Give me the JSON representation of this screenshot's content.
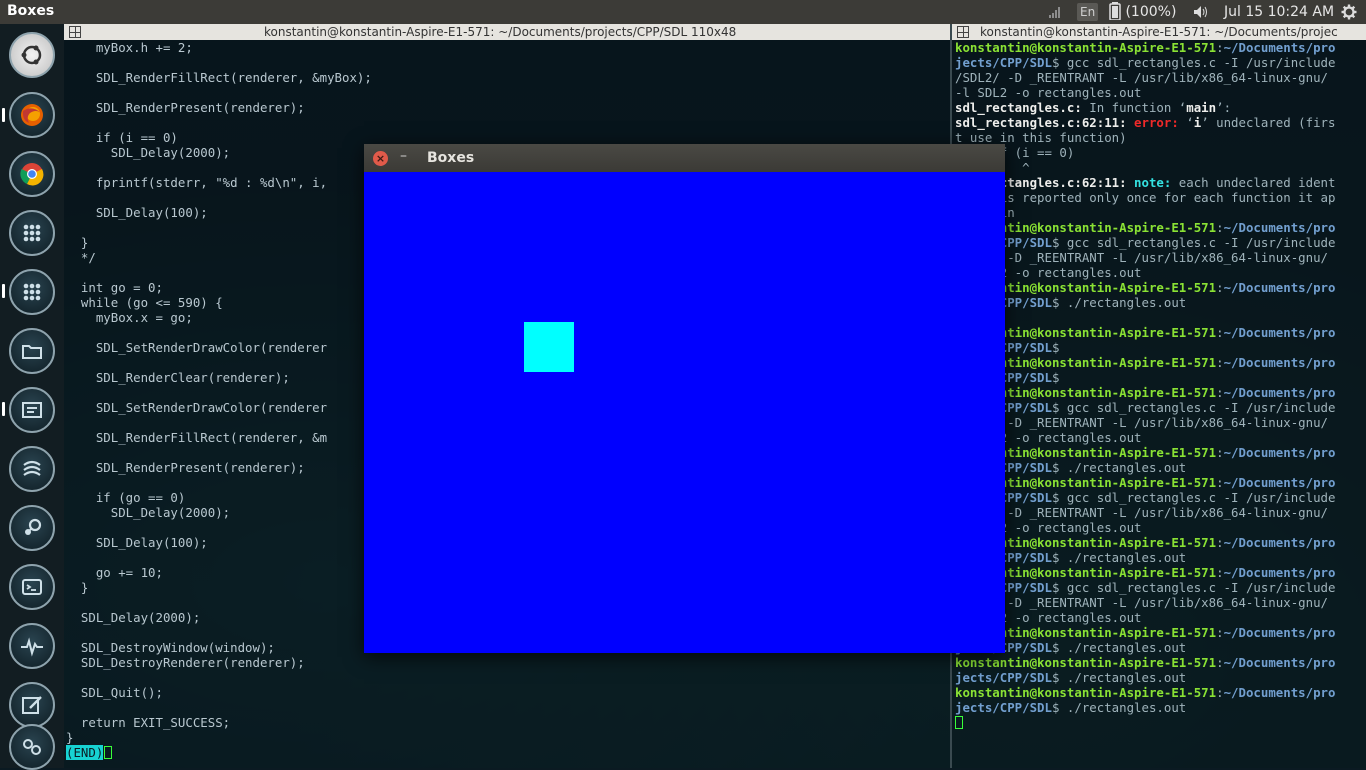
{
  "top_panel": {
    "app_title": "Boxes",
    "language": "En",
    "battery": "(100%)",
    "clock": "Jul 15 10:24 AM"
  },
  "launcher": {
    "items": [
      "ubuntu-dash",
      "firefox",
      "chrome",
      "apps",
      "apps",
      "files",
      "editor",
      "sublime",
      "steam",
      "terminal",
      "system-monitor",
      "paint",
      "settings",
      "trash"
    ]
  },
  "term_left": {
    "title": "konstantin@konstantin-Aspire-E1-571: ~/Documents/projects/CPP/SDL 110x48",
    "lines": [
      "    myBox.h += 2;",
      "",
      "    SDL_RenderFillRect(renderer, &myBox);",
      "",
      "    SDL_RenderPresent(renderer);",
      "",
      "    if (i == 0)",
      "      SDL_Delay(2000);",
      "",
      "    fprintf(stderr, \"%d : %d\\n\", i,",
      "",
      "    SDL_Delay(100);",
      "",
      "  }",
      "  */",
      "",
      "  int go = 0;",
      "  while (go <= 590) {",
      "    myBox.x = go;",
      "",
      "    SDL_SetRenderDrawColor(renderer",
      "",
      "    SDL_RenderClear(renderer);",
      "",
      "    SDL_SetRenderDrawColor(renderer",
      "",
      "    SDL_RenderFillRect(renderer, &m",
      "",
      "    SDL_RenderPresent(renderer);",
      "",
      "    if (go == 0)",
      "      SDL_Delay(2000);",
      "",
      "    SDL_Delay(100);",
      "",
      "    go += 10;",
      "  }",
      "",
      "  SDL_Delay(2000);",
      "",
      "  SDL_DestroyWindow(window);",
      "  SDL_DestroyRenderer(renderer);",
      "",
      "  SDL_Quit();",
      "",
      "  return EXIT_SUCCESS;",
      "}"
    ],
    "end_marker": "(END)"
  },
  "term_right": {
    "title": "konstantin@konstantin-Aspire-E1-571: ~/Documents/projec",
    "lines": [
      [
        {
          "c": "prompt-user",
          "t": "konstantin@konstantin-Aspire-E1-571"
        },
        {
          "c": "",
          "t": ":"
        },
        {
          "c": "prompt-path",
          "t": "~/Documents/pro"
        }
      ],
      [
        {
          "c": "prompt-path",
          "t": "jects/CPP/SDL"
        },
        {
          "c": "",
          "t": "$ gcc sdl_rectangles.c -I /usr/include"
        }
      ],
      [
        {
          "c": "",
          "t": "/SDL2/ -D _REENTRANT -L /usr/lib/x86_64-linux-gnu/"
        }
      ],
      [
        {
          "c": "",
          "t": "-l SDL2 -o rectangles.out"
        }
      ],
      [
        {
          "c": "err-file",
          "t": "sdl_rectangles.c:"
        },
        {
          "c": "",
          "t": " In function ‘"
        },
        {
          "c": "err-file",
          "t": "main"
        },
        {
          "c": "",
          "t": "’:"
        }
      ],
      [
        {
          "c": "err-file",
          "t": "sdl_rectangles.c:62:11:"
        },
        {
          "c": "err-word",
          "t": " error: "
        },
        {
          "c": "",
          "t": "‘"
        },
        {
          "c": "err-file",
          "t": "i"
        },
        {
          "c": "",
          "t": "’ undeclared (firs"
        }
      ],
      [
        {
          "c": "",
          "t": "t use in this function)"
        }
      ],
      [
        {
          "c": "",
          "t": "     if (i == 0)"
        }
      ],
      [
        {
          "c": "",
          "t": "         ^"
        }
      ],
      [
        {
          "c": "err-file",
          "t": "sdl_rectangles.c:62:11:"
        },
        {
          "c": "note-word",
          "t": " note: "
        },
        {
          "c": "",
          "t": "each undeclared ident"
        }
      ],
      [
        {
          "c": "",
          "t": "ifier is reported only once for each function it ap"
        }
      ],
      [
        {
          "c": "",
          "t": "pears in"
        }
      ],
      [
        {
          "c": "prompt-user",
          "t": "konstantin@konstantin-Aspire-E1-571"
        },
        {
          "c": "",
          "t": ":"
        },
        {
          "c": "prompt-path",
          "t": "~/Documents/pro"
        }
      ],
      [
        {
          "c": "prompt-path",
          "t": "jects/CPP/SDL"
        },
        {
          "c": "",
          "t": "$ gcc sdl_rectangles.c -I /usr/include"
        }
      ],
      [
        {
          "c": "",
          "t": "/SDL2/ -D _REENTRANT -L /usr/lib/x86_64-linux-gnu/"
        }
      ],
      [
        {
          "c": "",
          "t": "-l SDL2 -o rectangles.out"
        }
      ],
      [
        {
          "c": "prompt-user",
          "t": "konstantin@konstantin-Aspire-E1-571"
        },
        {
          "c": "",
          "t": ":"
        },
        {
          "c": "prompt-path",
          "t": "~/Documents/pro"
        }
      ],
      [
        {
          "c": "prompt-path",
          "t": "jects/CPP/SDL"
        },
        {
          "c": "",
          "t": "$ ./rectangles.out"
        }
      ],
      [
        {
          "c": "",
          "t": ""
        }
      ],
      [
        {
          "c": "prompt-user",
          "t": "konstantin@konstantin-Aspire-E1-571"
        },
        {
          "c": "",
          "t": ":"
        },
        {
          "c": "prompt-path",
          "t": "~/Documents/pro"
        }
      ],
      [
        {
          "c": "prompt-path",
          "t": "jects/CPP/SDL"
        },
        {
          "c": "",
          "t": "$"
        }
      ],
      [
        {
          "c": "prompt-user",
          "t": "konstantin@konstantin-Aspire-E1-571"
        },
        {
          "c": "",
          "t": ":"
        },
        {
          "c": "prompt-path",
          "t": "~/Documents/pro"
        }
      ],
      [
        {
          "c": "prompt-path",
          "t": "jects/CPP/SDL"
        },
        {
          "c": "",
          "t": "$"
        }
      ],
      [
        {
          "c": "prompt-user",
          "t": "konstantin@konstantin-Aspire-E1-571"
        },
        {
          "c": "",
          "t": ":"
        },
        {
          "c": "prompt-path",
          "t": "~/Documents/pro"
        }
      ],
      [
        {
          "c": "prompt-path",
          "t": "jects/CPP/SDL"
        },
        {
          "c": "",
          "t": "$ gcc sdl_rectangles.c -I /usr/include"
        }
      ],
      [
        {
          "c": "",
          "t": "/SDL2/ -D _REENTRANT -L /usr/lib/x86_64-linux-gnu/"
        }
      ],
      [
        {
          "c": "",
          "t": "-l SDL2 -o rectangles.out"
        }
      ],
      [
        {
          "c": "prompt-user",
          "t": "konstantin@konstantin-Aspire-E1-571"
        },
        {
          "c": "",
          "t": ":"
        },
        {
          "c": "prompt-path",
          "t": "~/Documents/pro"
        }
      ],
      [
        {
          "c": "prompt-path",
          "t": "jects/CPP/SDL"
        },
        {
          "c": "",
          "t": "$ ./rectangles.out"
        }
      ],
      [
        {
          "c": "prompt-user",
          "t": "konstantin@konstantin-Aspire-E1-571"
        },
        {
          "c": "",
          "t": ":"
        },
        {
          "c": "prompt-path",
          "t": "~/Documents/pro"
        }
      ],
      [
        {
          "c": "prompt-path",
          "t": "jects/CPP/SDL"
        },
        {
          "c": "",
          "t": "$ gcc sdl_rectangles.c -I /usr/include"
        }
      ],
      [
        {
          "c": "",
          "t": "/SDL2/ -D _REENTRANT -L /usr/lib/x86_64-linux-gnu/"
        }
      ],
      [
        {
          "c": "",
          "t": "-l SDL2 -o rectangles.out"
        }
      ],
      [
        {
          "c": "prompt-user",
          "t": "konstantin@konstantin-Aspire-E1-571"
        },
        {
          "c": "",
          "t": ":"
        },
        {
          "c": "prompt-path",
          "t": "~/Documents/pro"
        }
      ],
      [
        {
          "c": "prompt-path",
          "t": "jects/CPP/SDL"
        },
        {
          "c": "",
          "t": "$ ./rectangles.out"
        }
      ],
      [
        {
          "c": "prompt-user",
          "t": "konstantin@konstantin-Aspire-E1-571"
        },
        {
          "c": "",
          "t": ":"
        },
        {
          "c": "prompt-path",
          "t": "~/Documents/pro"
        }
      ],
      [
        {
          "c": "prompt-path",
          "t": "jects/CPP/SDL"
        },
        {
          "c": "",
          "t": "$ gcc sdl_rectangles.c -I /usr/include"
        }
      ],
      [
        {
          "c": "",
          "t": "/SDL2/ -D _REENTRANT -L /usr/lib/x86_64-linux-gnu/"
        }
      ],
      [
        {
          "c": "",
          "t": "-l SDL2 -o rectangles.out"
        }
      ],
      [
        {
          "c": "prompt-user",
          "t": "konstantin@konstantin-Aspire-E1-571"
        },
        {
          "c": "",
          "t": ":"
        },
        {
          "c": "prompt-path",
          "t": "~/Documents/pro"
        }
      ],
      [
        {
          "c": "prompt-path",
          "t": "jects/CPP/SDL"
        },
        {
          "c": "",
          "t": "$ ./rectangles.out"
        }
      ],
      [
        {
          "c": "prompt-user",
          "t": "konstantin@konstantin-Aspire-E1-571"
        },
        {
          "c": "",
          "t": ":"
        },
        {
          "c": "prompt-path",
          "t": "~/Documents/pro"
        }
      ],
      [
        {
          "c": "prompt-path",
          "t": "jects/CPP/SDL"
        },
        {
          "c": "",
          "t": "$ ./rectangles.out"
        }
      ],
      [
        {
          "c": "prompt-user",
          "t": "konstantin@konstantin-Aspire-E1-571"
        },
        {
          "c": "",
          "t": ":"
        },
        {
          "c": "prompt-path",
          "t": "~/Documents/pro"
        }
      ],
      [
        {
          "c": "prompt-path",
          "t": "jects/CPP/SDL"
        },
        {
          "c": "",
          "t": "$ ./rectangles.out"
        }
      ]
    ]
  },
  "sdl_window": {
    "title": "Boxes",
    "close_glyph": "×",
    "minimize_glyph": "–",
    "canvas_color": "#0000ff",
    "box_color": "#00ffff"
  }
}
